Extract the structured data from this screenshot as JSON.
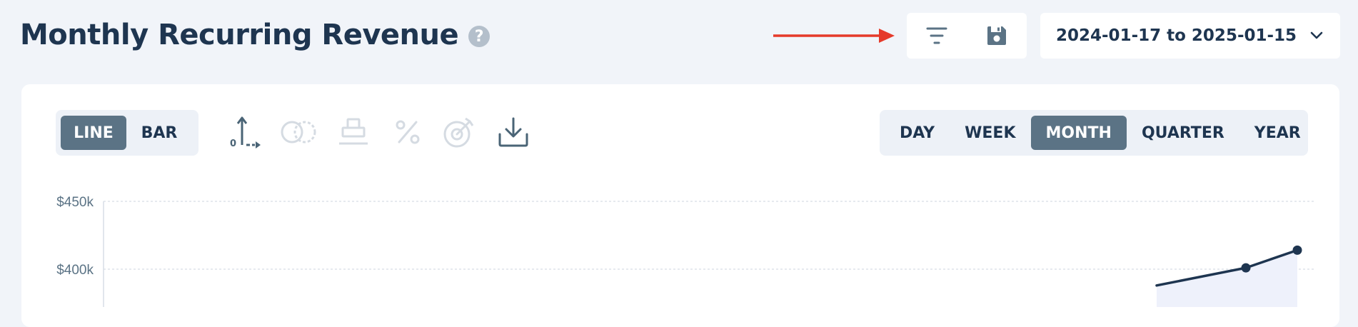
{
  "page": {
    "title": "Monthly Recurring Revenue",
    "help_glyph": "?"
  },
  "header_actions": {
    "filter_icon": "filter-icon",
    "save_icon": "floppy-disk-icon",
    "annotation_arrow_color": "#e53a2a"
  },
  "date_range": {
    "value": "2024-01-17 to 2025-01-15",
    "chevron_icon": "chevron-down-icon"
  },
  "chart_type_toggle": {
    "options": [
      "LINE",
      "BAR"
    ],
    "selected": "LINE"
  },
  "toolbar_icons": [
    {
      "name": "axis-origin-icon",
      "enabled": true
    },
    {
      "name": "compare-circles-icon",
      "enabled": false
    },
    {
      "name": "stack-icon",
      "enabled": false
    },
    {
      "name": "percent-icon",
      "enabled": false
    },
    {
      "name": "target-goal-icon",
      "enabled": false
    },
    {
      "name": "download-icon",
      "enabled": true
    }
  ],
  "period_toggle": {
    "options": [
      "DAY",
      "WEEK",
      "MONTH",
      "QUARTER",
      "YEAR"
    ],
    "selected": "MONTH"
  },
  "colors": {
    "accent_active": "#5b7385",
    "line": "#1e3550",
    "area_fill": "#eef1fb",
    "grid": "#d7dde5"
  },
  "chart_data": {
    "type": "line",
    "y_tick_labels": [
      "$450k",
      "$400k"
    ],
    "y_ticks": [
      450000,
      400000
    ],
    "ylim": [
      360000,
      450000
    ],
    "grid": true,
    "visible_points": [
      {
        "y": 388000
      },
      {
        "y": 401000
      },
      {
        "y": 414000
      }
    ]
  }
}
